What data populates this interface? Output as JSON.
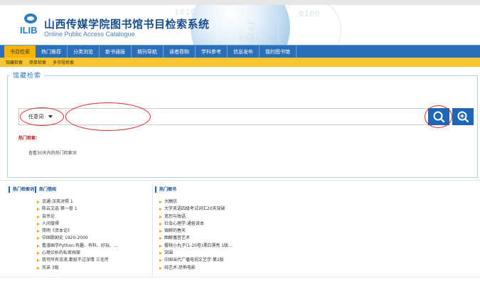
{
  "header": {
    "logo_text": "ILIB",
    "title_cn": "山西传媒学院图书馆书目检索系统",
    "title_en": "Online Public Access Catalogue",
    "deco_digits": [
      "1010",
      "0100",
      "0001",
      "10100"
    ]
  },
  "nav": {
    "items": [
      {
        "label": "书目检索",
        "active": true
      },
      {
        "label": "热门推荐",
        "active": false
      },
      {
        "label": "分类浏览",
        "active": false
      },
      {
        "label": "新书通报",
        "active": false
      },
      {
        "label": "期刊导航",
        "active": false
      },
      {
        "label": "读者荐购",
        "active": false
      },
      {
        "label": "学科参考",
        "active": false
      },
      {
        "label": "信息发布",
        "active": false
      },
      {
        "label": "我的图书馆",
        "active": false
      }
    ],
    "subitems": [
      "馆藏检索",
      "简单检索",
      "多字段检索"
    ]
  },
  "search": {
    "panel_title": "馆藏检索",
    "field_selected": "任意词",
    "query_value": "",
    "query_placeholder": "",
    "search_icon": "search-icon",
    "advanced_icon": "zoom-in-plus-icon",
    "hot_label": "热门检索：",
    "hot_link": "查看30天内的热门检索词"
  },
  "lists": {
    "left_tabs": [
      "热门检索词",
      "热门借阅"
    ],
    "left_items": [
      "流通:汉英对照 1",
      "陈云文选 第一卷 1",
      "自杀论",
      "人间值得",
      "简明《资本论》",
      "中国歌剧史 1920-2000",
      "看漫画学Python:有趣、有料、好玩、...",
      "心理诊析的私密档案",
      "我可所有流浪,都抵不过深情 三毛传",
      "兄弟 3版"
    ],
    "right_title": "热门图书",
    "right_items": [
      "大酬坊",
      "大学英语四级考试词汇20天突破",
      "宽恕与独语",
      "社会心理学:通俗读本",
      "宿醉的春天",
      "图解播音艺术",
      "樱桃小丸子(1-20卷)漂白漂亮 1版...",
      "突围",
      "中国当代广播电视文艺学 第2版",
      "纯艺术:恐怖电影"
    ]
  },
  "colors": {
    "nav_blue": "#2a6fb8",
    "nav_active": "#f7b400",
    "subbar_yellow": "#f7c531",
    "button_blue": "#1e67b6",
    "annotation_red": "#d9262c",
    "hot_red": "#c0182b"
  }
}
